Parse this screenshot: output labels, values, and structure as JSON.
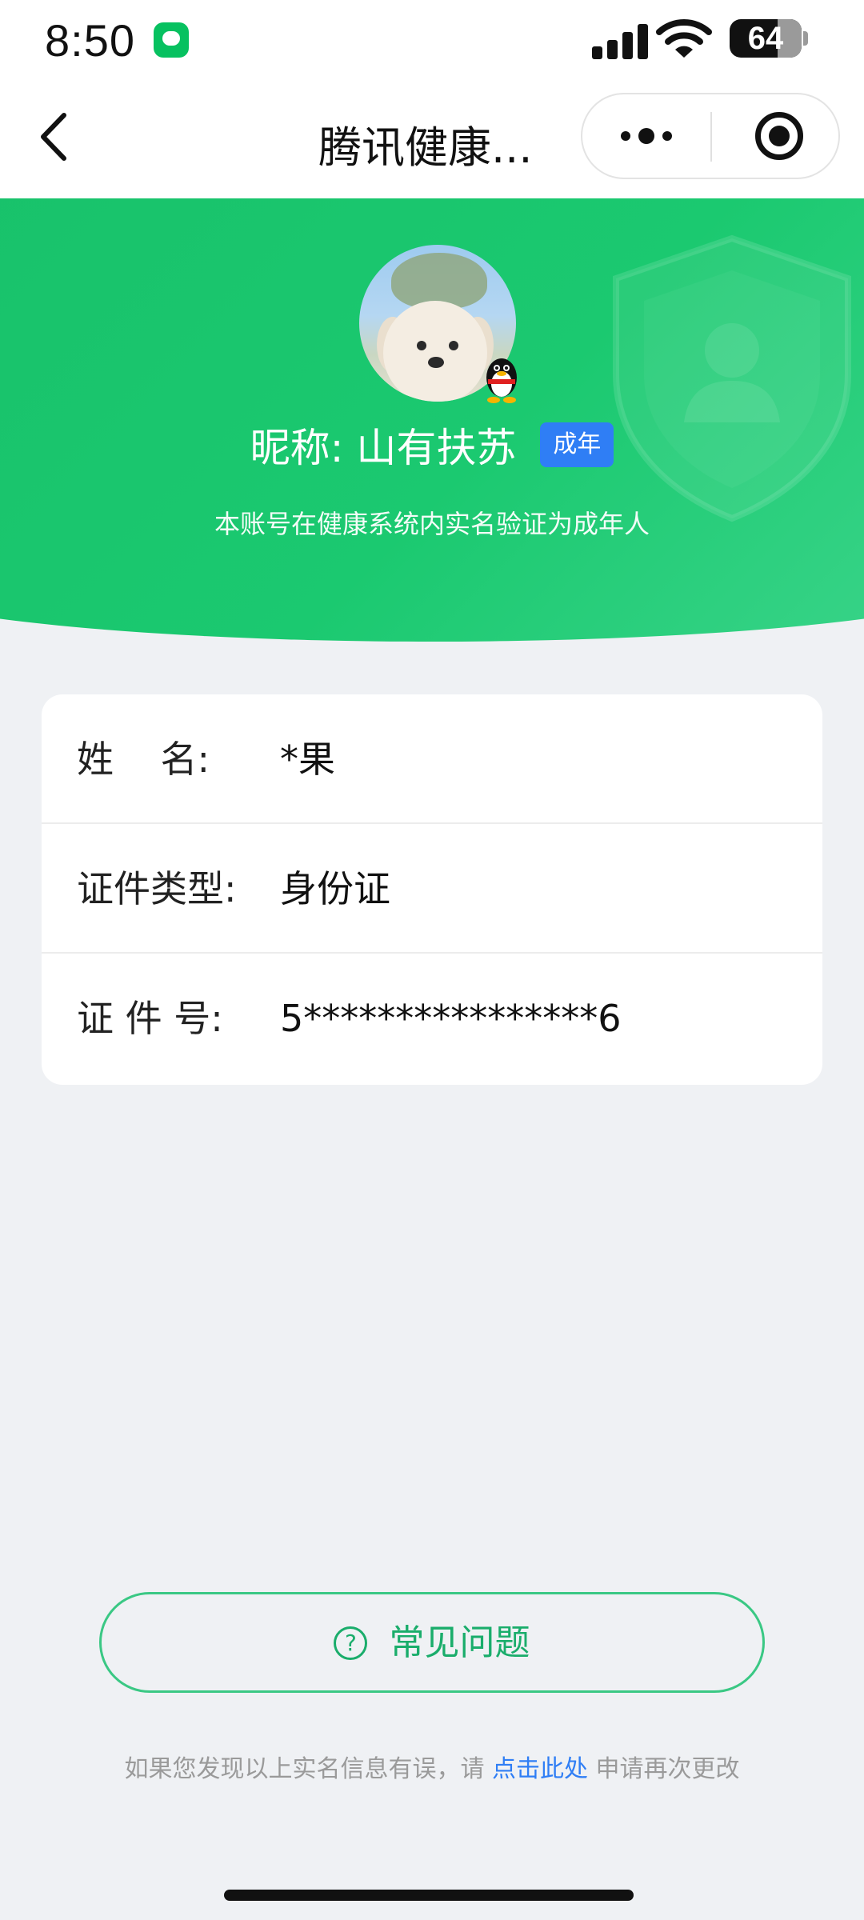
{
  "status_bar": {
    "time": "8:50",
    "battery_level": "64"
  },
  "nav": {
    "title": "腾讯健康..."
  },
  "profile": {
    "nickname": "昵称: 山有扶苏",
    "badge": "成年",
    "subtitle": "本账号在健康系统内实名验证为成年人"
  },
  "info": {
    "rows": [
      {
        "label": "姓    名:",
        "value": "*果"
      },
      {
        "label": "证件类型:",
        "value": "身份证"
      },
      {
        "label": "证 件 号:",
        "value": "5****************6"
      }
    ]
  },
  "faq": {
    "label": "常见问题",
    "icon": "help-circle-icon"
  },
  "footer": {
    "prefix": "如果您发现以上实名信息有误，请 ",
    "link": "点击此处",
    "suffix": " 申请再次更改"
  },
  "colors": {
    "brand_green": "#1bc970",
    "badge_blue": "#2f7ef5",
    "link_blue": "#2f7ef5",
    "page_bg": "#eff1f4"
  }
}
